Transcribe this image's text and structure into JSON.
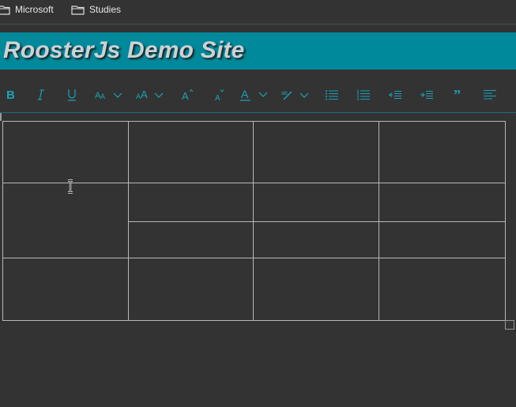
{
  "bookmarks": [
    {
      "label": "Microsoft",
      "icon": "folder-icon"
    },
    {
      "label": "Studies",
      "icon": "folder-icon"
    }
  ],
  "banner": {
    "title": "RoosterJs Demo Site"
  },
  "toolbar": {
    "buttons": [
      {
        "name": "bold-button",
        "icon": "bold-icon"
      },
      {
        "name": "italic-button",
        "icon": "italic-icon"
      },
      {
        "name": "underline-button",
        "icon": "underline-icon"
      },
      {
        "name": "font-button",
        "icon": "font-icon"
      },
      {
        "name": "font-size-button",
        "icon": "font-size-icon"
      },
      {
        "name": "increase-font-size-button",
        "icon": "increase-font-size-icon"
      },
      {
        "name": "decrease-font-size-button",
        "icon": "decrease-font-size-icon"
      },
      {
        "name": "text-color-button",
        "icon": "text-color-icon"
      },
      {
        "name": "highlight-button",
        "icon": "highlight-icon"
      },
      {
        "name": "bullet-list-button",
        "icon": "bullet-list-icon"
      },
      {
        "name": "numbered-list-button",
        "icon": "numbered-list-icon"
      },
      {
        "name": "decrease-indent-button",
        "icon": "decrease-indent-icon"
      },
      {
        "name": "increase-indent-button",
        "icon": "increase-indent-icon"
      },
      {
        "name": "quote-button",
        "icon": "quote-icon"
      },
      {
        "name": "align-left-button",
        "icon": "align-left-icon"
      }
    ],
    "accent": "#1aa3b4"
  },
  "editor": {
    "table": {
      "rows": 4,
      "columns": 4,
      "border_color": "#b8b8b8"
    }
  },
  "colors": {
    "background": "#333333",
    "banner": "#00899a",
    "banner_text": "#c9d3d7"
  }
}
